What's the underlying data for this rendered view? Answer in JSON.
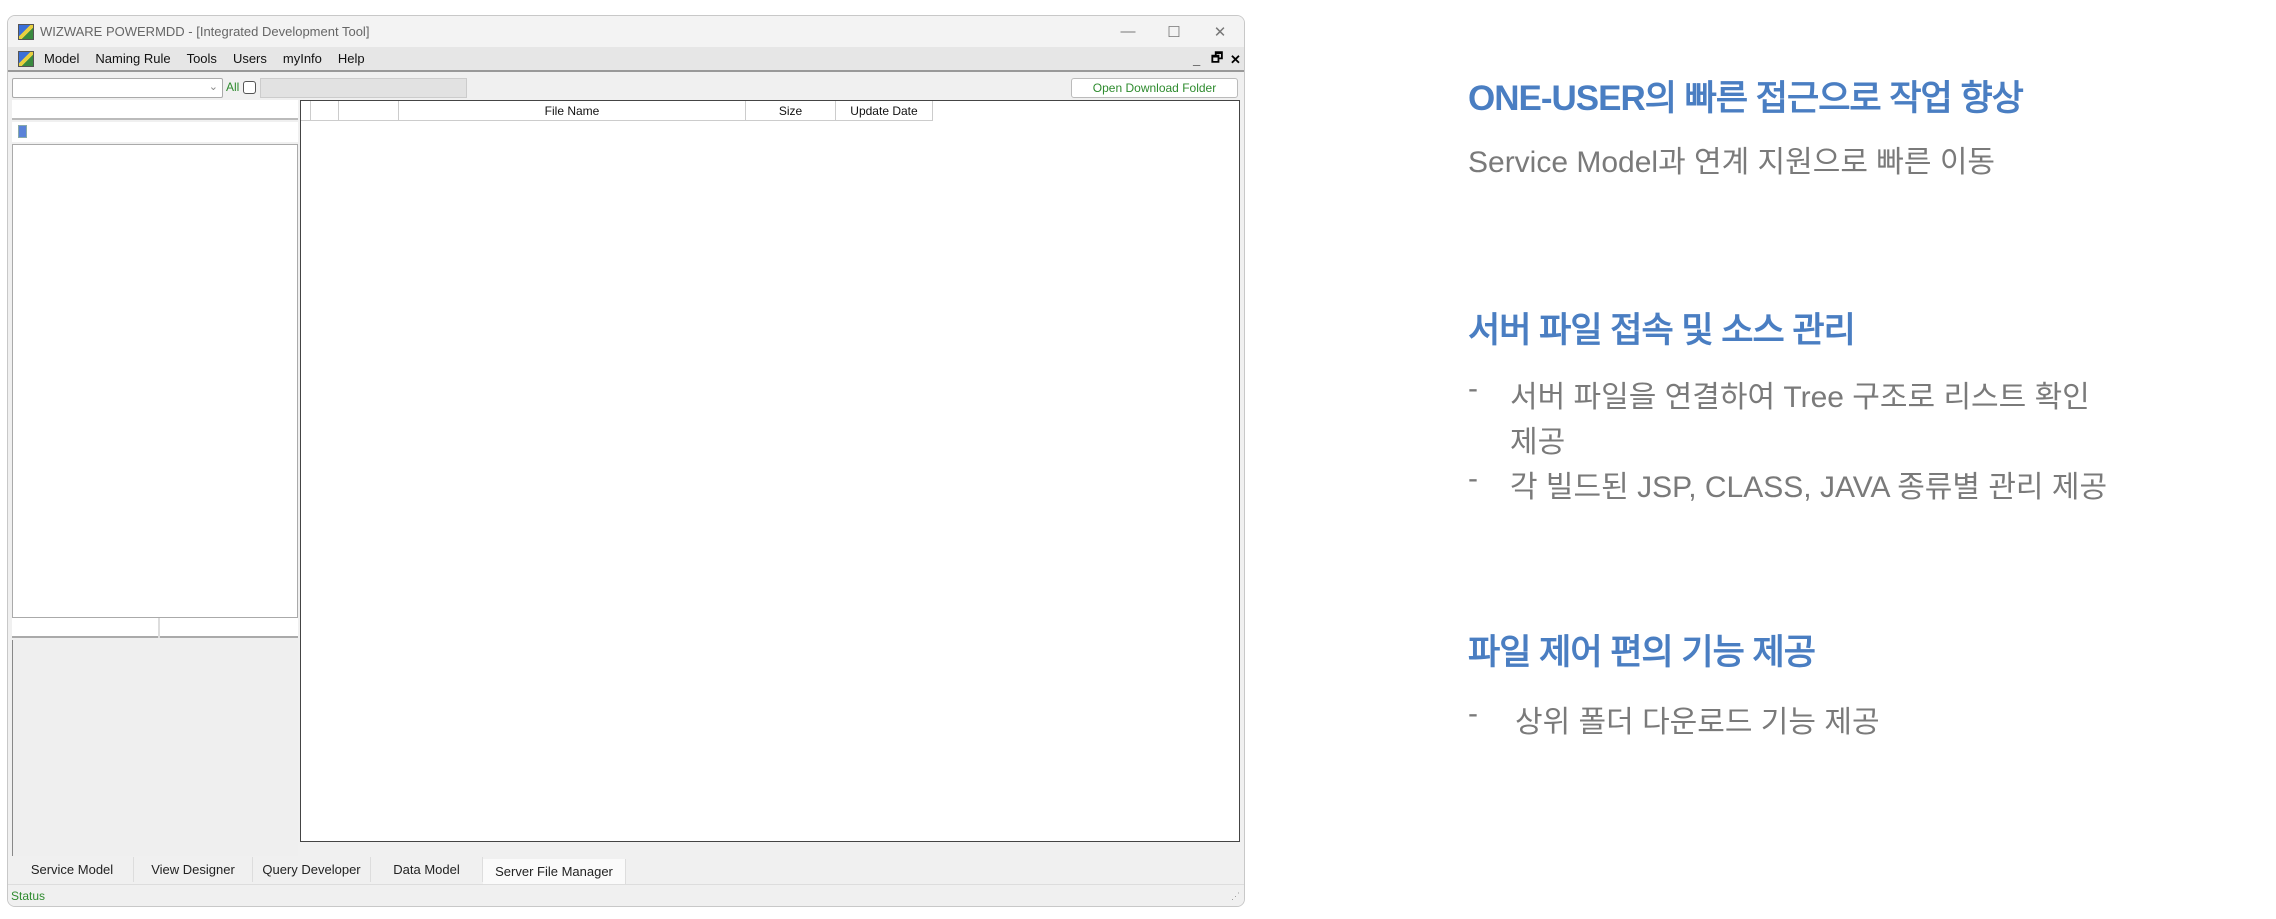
{
  "window": {
    "title": "WIZWARE POWERMDD - [Integrated Development Tool]"
  },
  "menu": [
    "Model",
    "Naming Rule",
    "Tools",
    "Users",
    "myInfo",
    "Help"
  ],
  "toolbar": {
    "all_label": "All",
    "open_download_folder": "Open Download Folder",
    "combo_value": "",
    "filter_value": ""
  },
  "grid": {
    "columns": [
      "",
      "",
      "",
      "File Name",
      "Size",
      "Update Date"
    ],
    "rows": []
  },
  "tabs": [
    {
      "label": "Service Model",
      "active": false
    },
    {
      "label": "View Designer",
      "active": false
    },
    {
      "label": "Query Developer",
      "active": false
    },
    {
      "label": "Data Model",
      "active": false
    },
    {
      "label": "Server File Manager",
      "active": true
    }
  ],
  "status": {
    "text": "Status",
    "color": "#2e8b2e"
  },
  "panel": {
    "sections": [
      {
        "heading": "ONE-USER의 빠른 접근으로 작업 향상",
        "text": "Service Model과 연계 지원으로 빠른 이동"
      },
      {
        "heading": "서버 파일 접속 및 소스 관리",
        "bullets": [
          "서버 파일을 연결하여 Tree 구조로 리스트 확인",
          "제공",
          "각 빌드된 JSP, CLASS, JAVA 종류별 관리 제공"
        ]
      },
      {
        "heading": "파일 제어 편의 기능 제공",
        "bullets": [
          "상위 폴더 다운로드 기능 제공"
        ]
      }
    ],
    "dash": "-",
    "heading_color": "#4a7ec2"
  }
}
